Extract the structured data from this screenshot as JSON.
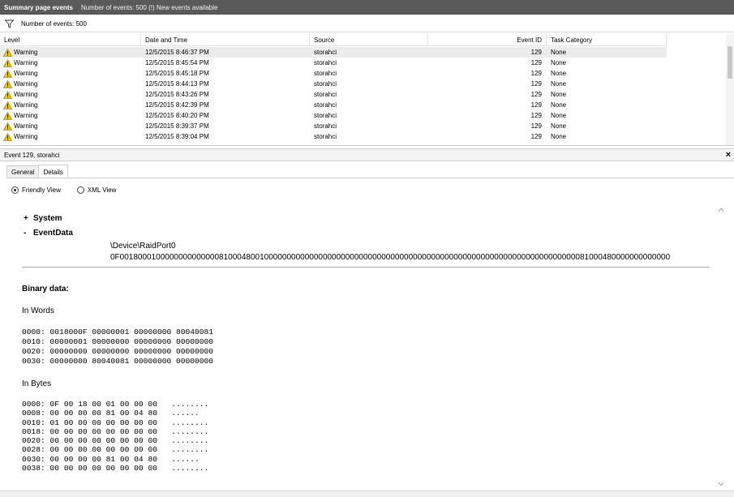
{
  "titlebar": {
    "title": "Summary page events",
    "status": "Number of events: 500 (!) New events available"
  },
  "filter": {
    "count_text": "Number of events: 500"
  },
  "grid": {
    "columns": [
      "Level",
      "Date and Time",
      "Source",
      "Event ID",
      "Task Category"
    ],
    "rows": [
      {
        "level": "Warning",
        "date": "12/5/2015 8:46:37 PM",
        "source": "storahci",
        "id": "129",
        "task": "None"
      },
      {
        "level": "Warning",
        "date": "12/5/2015 8:45:54 PM",
        "source": "storahci",
        "id": "129",
        "task": "None"
      },
      {
        "level": "Warning",
        "date": "12/5/2015 8:45:18 PM",
        "source": "storahci",
        "id": "129",
        "task": "None"
      },
      {
        "level": "Warning",
        "date": "12/5/2015 8:44:13 PM",
        "source": "storahci",
        "id": "129",
        "task": "None"
      },
      {
        "level": "Warning",
        "date": "12/5/2015 8:43:26 PM",
        "source": "storahci",
        "id": "129",
        "task": "None"
      },
      {
        "level": "Warning",
        "date": "12/5/2015 8:42:39 PM",
        "source": "storahci",
        "id": "129",
        "task": "None"
      },
      {
        "level": "Warning",
        "date": "12/5/2015 8:40:20 PM",
        "source": "storahci",
        "id": "129",
        "task": "None"
      },
      {
        "level": "Warning",
        "date": "12/5/2015 8:39:37 PM",
        "source": "storahci",
        "id": "129",
        "task": "None"
      },
      {
        "level": "Warning",
        "date": "12/5/2015 8:39:04 PM",
        "source": "storahci",
        "id": "129",
        "task": "None"
      }
    ]
  },
  "detail": {
    "header": "Event 129, storahci",
    "tabs": [
      "General",
      "Details"
    ],
    "views": [
      "Friendly View",
      "XML View"
    ],
    "tree": {
      "system": "System",
      "eventdata": "EventData"
    },
    "eventdata_values": [
      "\\Device\\RaidPort0",
      "0F00180001000000000000008100048001000000000000000000000000000000000000000000000000000000000000000000000081000480000000000000"
    ],
    "binary_title": "Binary data:",
    "in_words_label": "In Words",
    "in_words": "0000: 0018000F 00000001 00000000 80040081\n0010: 00000001 00000000 00000000 00000000\n0020: 00000000 00000000 00000000 00000000\n0030: 00000000 80040081 00000000 00000000",
    "in_bytes_label": "In Bytes",
    "in_bytes": "0000: 0F 00 18 00 01 00 00 00   ........\n0008: 00 00 00 00 81 00 04 80   ......\n0010: 01 00 00 00 00 00 00 00   ........\n0018: 00 00 00 00 00 00 00 00   ........\n0020: 00 00 00 00 00 00 00 00   ........\n0028: 00 00 00 00 00 00 00 00   ........\n0030: 00 00 00 00 81 00 04 80   ......\n0038: 00 00 00 00 00 00 00 00   ........"
  },
  "colors": {
    "titlebar": "#5a5a5a",
    "warning_yellow": "#f5c400",
    "selected_row": "#ececec"
  },
  "icons": {
    "filter": "funnel-icon",
    "warning": "warning-triangle-icon",
    "close": "close-icon"
  }
}
